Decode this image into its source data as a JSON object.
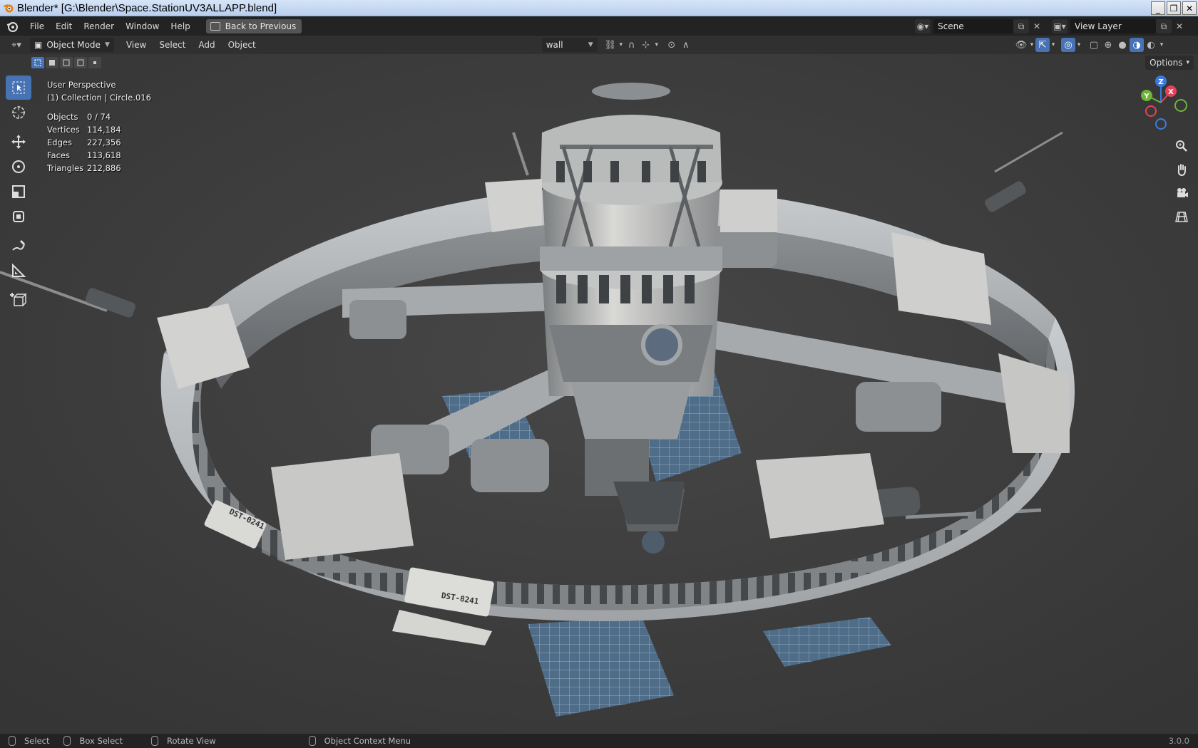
{
  "window": {
    "title": "Blender* [G:\\Blender\\Space.StationUV3ALLAPP.blend]",
    "buttons": [
      "_",
      "❐",
      "✕"
    ]
  },
  "topbar": {
    "menus": [
      "File",
      "Edit",
      "Render",
      "Window",
      "Help"
    ],
    "back_label": "Back to Previous",
    "scene_name": "Scene",
    "view_layer": "View Layer"
  },
  "viewport_header": {
    "mode": "Object Mode",
    "menus": [
      "View",
      "Select",
      "Add",
      "Object"
    ],
    "material_slot": "wall"
  },
  "viewport": {
    "options_label": "Options",
    "perspective": "User Perspective",
    "collection": "(1) Collection | Circle.016",
    "stats": [
      {
        "label": "Objects",
        "value": "0 / 74"
      },
      {
        "label": "Vertices",
        "value": "114,184"
      },
      {
        "label": "Edges",
        "value": "227,356"
      },
      {
        "label": "Faces",
        "value": "113,618"
      },
      {
        "label": "Triangles",
        "value": "212,886"
      }
    ],
    "gizmo_axes": [
      "Z",
      "X",
      "Y"
    ],
    "labels": [
      "DST-0241",
      "DST-8241"
    ]
  },
  "statusbar": {
    "select": "Select",
    "box_select": "Box Select",
    "rotate": "Rotate View",
    "context": "Object Context Menu",
    "version": "3.0.0"
  }
}
